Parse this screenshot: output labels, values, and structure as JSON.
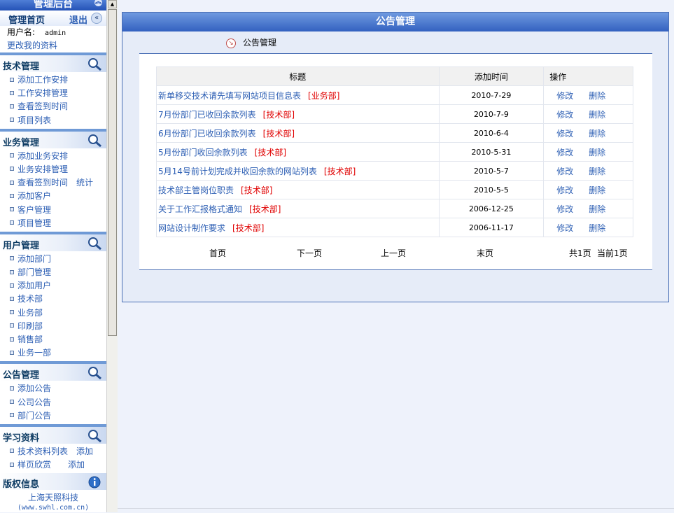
{
  "sidebar": {
    "header_title": "管理后台",
    "home_label": "管理首页",
    "logout_label": "退出",
    "user_label": "用户名:",
    "user_value": "admin",
    "profile_link": "更改我的资料",
    "sections": [
      {
        "title": "技术管理",
        "items": [
          "添加工作安排",
          "工作安排管理",
          "查看签到时间",
          "项目列表"
        ]
      },
      {
        "title": "业务管理",
        "items": [
          "添加业务安排",
          "业务安排管理",
          "查看签到时间",
          "添加客户",
          "客户管理",
          "项目管理"
        ],
        "extra_on_item_3": "统计"
      },
      {
        "title": "用户管理",
        "items": [
          "添加部门",
          "部门管理",
          "添加用户",
          "技术部",
          "业务部",
          "印刷部",
          "销售部",
          "业务一部"
        ]
      },
      {
        "title": "公告管理",
        "items": [
          "添加公告",
          "公司公告",
          "部门公告"
        ]
      },
      {
        "title": "学习资料",
        "items": [
          "技术资料列表",
          "样页欣赏"
        ],
        "extras": [
          "添加",
          "添加"
        ]
      }
    ],
    "copyright": {
      "title": "版权信息",
      "company": "上海天照科技",
      "url": "(www.swhl.com.cn)"
    }
  },
  "main": {
    "panel_title": "公告管理",
    "breadcrumb": "公告管理",
    "table": {
      "headers": [
        "标题",
        "添加时间",
        "操作"
      ],
      "edit_label": "修改",
      "delete_label": "删除",
      "rows": [
        {
          "title": "新单移交技术请先填写网站项目信息表",
          "dept": "[业务部]",
          "date": "2010-7-29"
        },
        {
          "title": "7月份部门已收回余款列表",
          "dept": "[技术部]",
          "date": "2010-7-9"
        },
        {
          "title": "6月份部门已收回余款列表",
          "dept": "[技术部]",
          "date": "2010-6-4"
        },
        {
          "title": "5月份部门收回余款列表",
          "dept": "[技术部]",
          "date": "2010-5-31"
        },
        {
          "title": "5月14号前计划完成并收回余款的网站列表",
          "dept": "[技术部]",
          "date": "2010-5-7"
        },
        {
          "title": "技术部主管岗位职责",
          "dept": "[技术部]",
          "date": "2010-5-5"
        },
        {
          "title": "关于工作汇报格式通知",
          "dept": "[技术部]",
          "date": "2006-12-25"
        },
        {
          "title": "网站设计制作要求",
          "dept": "[技术部]",
          "date": "2006-11-17"
        }
      ]
    },
    "pager": {
      "first": "首页",
      "next": "下一页",
      "prev": "上一页",
      "last": "末页",
      "total": "共1页",
      "current": "当前1页"
    }
  }
}
